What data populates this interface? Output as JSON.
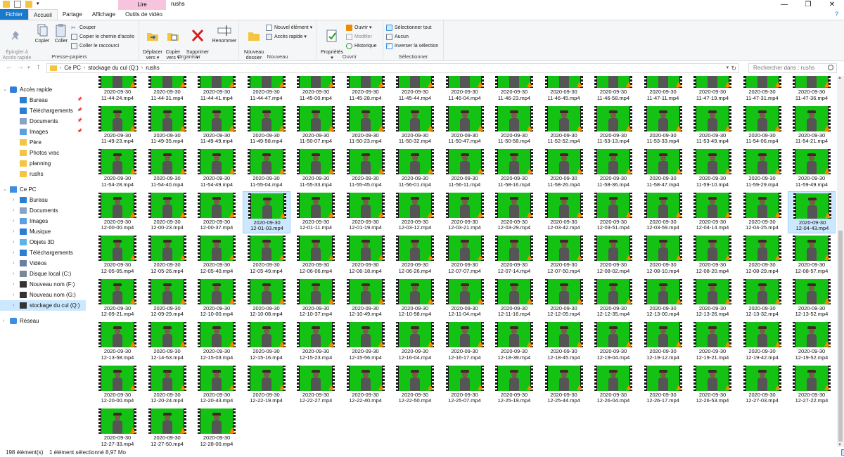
{
  "window": {
    "title": "rushs",
    "context_tab": "Lire",
    "controls": [
      "—",
      "❐",
      "✕"
    ]
  },
  "ribbon_tabs": [
    {
      "label": "Fichier",
      "kind": "file"
    },
    {
      "label": "Accueil",
      "kind": "active"
    },
    {
      "label": "Partage",
      "kind": "normal"
    },
    {
      "label": "Affichage",
      "kind": "normal"
    },
    {
      "label": "Outils de vidéo",
      "kind": "normal"
    }
  ],
  "ribbon": {
    "presse_papiers": {
      "label": "Presse-papiers",
      "pin": "Épingler à\nAccès rapide",
      "copy": "Copier",
      "paste": "Coller",
      "cut": "Couper",
      "copy_path": "Copier le chemin d'accès",
      "paste_shortcut": "Coller le raccourci"
    },
    "organiser": {
      "label": "Organiser",
      "move_to": "Déplacer\nvers ▾",
      "copy_to": "Copier\nvers ▾",
      "delete": "Supprimer\n▾",
      "rename": "Renommer"
    },
    "nouveau": {
      "label": "Nouveau",
      "new_folder": "Nouveau\ndossier",
      "new_item": "Nouvel élément ▾",
      "easy_access": "Accès rapide ▾"
    },
    "ouvrir": {
      "label": "Ouvrir",
      "properties": "Propriétés\n▾",
      "open": "Ouvrir ▾",
      "edit": "Modifier",
      "history": "Historique"
    },
    "selectionner": {
      "label": "Sélectionner",
      "select_all": "Sélectionner tout",
      "select_none": "Aucun",
      "invert": "Inverser la sélection"
    }
  },
  "address": {
    "crumbs": [
      "Ce PC",
      "stockage du cul (Q:)",
      "rushs"
    ],
    "search_placeholder": "Rechercher dans : rushs"
  },
  "sidebar": {
    "quick_access": {
      "label": "Accès rapide",
      "items": [
        "Bureau",
        "Téléchargements",
        "Documents",
        "Images",
        "Père",
        "Photos vrac",
        "planning",
        "rushs"
      ]
    },
    "this_pc": {
      "label": "Ce PC",
      "items": [
        "Bureau",
        "Documents",
        "Images",
        "Musique",
        "Objets 3D",
        "Téléchargements",
        "Vidéos",
        "Disque local (C:)",
        "Nouveau nom (F:)",
        "Nouveau nom (G:)",
        "stockage du cul (Q:)"
      ]
    },
    "network": {
      "label": "Réseau"
    }
  },
  "files": {
    "date_line": "2020-09-30",
    "selected": [
      "12-01-03.mp4",
      "12-04-43.mp4"
    ],
    "names": [
      "11-44-24.mp4",
      "11-44-31.mp4",
      "11-44-41.mp4",
      "11-44-47.mp4",
      "11-45-00.mp4",
      "11-45-28.mp4",
      "11-45-44.mp4",
      "11-46-04.mp4",
      "11-46-23.mp4",
      "11-46-45.mp4",
      "11-46-58.mp4",
      "11-47-11.mp4",
      "11-47-19.mp4",
      "11-47-31.mp4",
      "11-47-36.mp4",
      "11-49-23.mp4",
      "11-49-35.mp4",
      "11-49-49.mp4",
      "11-49-58.mp4",
      "11-50-07.mp4",
      "11-50-23.mp4",
      "11-50-32.mp4",
      "11-50-47.mp4",
      "11-50-58.mp4",
      "11-52-52.mp4",
      "11-53-13.mp4",
      "11-53-33.mp4",
      "11-53-49.mp4",
      "11-54-06.mp4",
      "11-54-21.mp4",
      "11-54-28.mp4",
      "11-54-40.mp4",
      "11-54-49.mp4",
      "11-55-04.mp4",
      "11-55-33.mp4",
      "11-55-45.mp4",
      "11-56-01.mp4",
      "11-56-11.mp4",
      "11-58-16.mp4",
      "11-58-26.mp4",
      "11-58-36.mp4",
      "11-58-47.mp4",
      "11-59-10.mp4",
      "11-59-29.mp4",
      "11-59-49.mp4",
      "12-00-00.mp4",
      "12-00-23.mp4",
      "12-00-37.mp4",
      "12-01-03.mp4",
      "12-01-11.mp4",
      "12-01-19.mp4",
      "12-03-12.mp4",
      "12-03-21.mp4",
      "12-03-29.mp4",
      "12-03-42.mp4",
      "12-03-51.mp4",
      "12-03-59.mp4",
      "12-04-14.mp4",
      "12-04-25.mp4",
      "12-04-43.mp4",
      "12-05-05.mp4",
      "12-05-26.mp4",
      "12-05-40.mp4",
      "12-05-49.mp4",
      "12-06-06.mp4",
      "12-06-18.mp4",
      "12-06-26.mp4",
      "12-07-07.mp4",
      "12-07-14.mp4",
      "12-07-50.mp4",
      "12-08-02.mp4",
      "12-08-10.mp4",
      "12-08-20.mp4",
      "12-08-29.mp4",
      "12-08-57.mp4",
      "12-09-21.mp4",
      "12-09-29.mp4",
      "12-10-00.mp4",
      "12-10-08.mp4",
      "12-10-37.mp4",
      "12-10-49.mp4",
      "12-10-58.mp4",
      "12-11-04.mp4",
      "12-11-16.mp4",
      "12-12-05.mp4",
      "12-12-35.mp4",
      "12-13-00.mp4",
      "12-13-26.mp4",
      "12-13-32.mp4",
      "12-13-52.mp4",
      "12-13-58.mp4",
      "12-14-53.mp4",
      "12-15-03.mp4",
      "12-15-16.mp4",
      "12-15-23.mp4",
      "12-15-56.mp4",
      "12-16-04.mp4",
      "12-16-17.mp4",
      "12-18-39.mp4",
      "12-18-45.mp4",
      "12-19-04.mp4",
      "12-19-12.mp4",
      "12-19-21.mp4",
      "12-19-42.mp4",
      "12-19-52.mp4",
      "12-20-00.mp4",
      "12-20-24.mp4",
      "12-20-43.mp4",
      "12-22-19.mp4",
      "12-22-27.mp4",
      "12-22-40.mp4",
      "12-22-50.mp4",
      "12-25-07.mp4",
      "12-25-19.mp4",
      "12-25-44.mp4",
      "12-26-04.mp4",
      "12-26-17.mp4",
      "12-26-53.mp4",
      "12-27-03.mp4",
      "12-27-22.mp4",
      "12-27-33.mp4",
      "12-27-50.mp4",
      "12-28-00.mp4"
    ]
  },
  "status": {
    "count": "198 élément(s)",
    "selection": "1 élément sélectionné  8,97 Mo"
  },
  "colors": {
    "accent": "#1979ca",
    "selection": "#cce8ff",
    "greenscreen": "#14c214"
  }
}
